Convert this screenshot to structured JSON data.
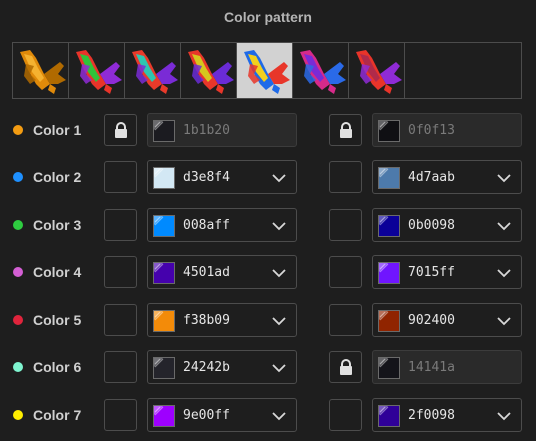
{
  "title": "Color pattern",
  "patterns": [
    {
      "name": "pattern-1",
      "colors": [
        "#e08a0a",
        "#b06a00",
        "#f5b230"
      ],
      "selected": false
    },
    {
      "name": "pattern-2",
      "colors": [
        "#e8342a",
        "#8f2bd6",
        "#2fc33a"
      ],
      "selected": false
    },
    {
      "name": "pattern-3",
      "colors": [
        "#e83a2a",
        "#7a2bd6",
        "#2ec6b0"
      ],
      "selected": false
    },
    {
      "name": "pattern-4",
      "colors": [
        "#e8362a",
        "#6a2bd6",
        "#d6c61e"
      ],
      "selected": false
    },
    {
      "name": "pattern-5",
      "colors": [
        "#1e6ae8",
        "#e8362a",
        "#f2d01e"
      ],
      "selected": true
    },
    {
      "name": "pattern-6",
      "colors": [
        "#d62a8a",
        "#2a6ae8",
        "#7a2bd6"
      ],
      "selected": false
    },
    {
      "name": "pattern-7",
      "colors": [
        "#e8342a",
        "#8f2bd6",
        "#b02a4a"
      ],
      "selected": false
    }
  ],
  "rows": [
    {
      "label": "Color 1",
      "dot": "#f39c12",
      "left": {
        "hex": "1b1b20",
        "color": "#1b1b20",
        "locked": true
      },
      "right": {
        "hex": "0f0f13",
        "color": "#0f0f13",
        "locked": true
      }
    },
    {
      "label": "Color 2",
      "dot": "#1e90ff",
      "left": {
        "hex": "d3e8f4",
        "color": "#d3e8f4",
        "locked": false
      },
      "right": {
        "hex": "4d7aab",
        "color": "#4d7aab",
        "locked": false
      }
    },
    {
      "label": "Color 3",
      "dot": "#2ecc40",
      "left": {
        "hex": "008aff",
        "color": "#008aff",
        "locked": false
      },
      "right": {
        "hex": "0b0098",
        "color": "#0b0098",
        "locked": false
      }
    },
    {
      "label": "Color 4",
      "dot": "#d45fd4",
      "left": {
        "hex": "4501ad",
        "color": "#4501ad",
        "locked": false
      },
      "right": {
        "hex": "7015ff",
        "color": "#7015ff",
        "locked": false
      }
    },
    {
      "label": "Color 5",
      "dot": "#e0243c",
      "left": {
        "hex": "f38b09",
        "color": "#f38b09",
        "locked": false
      },
      "right": {
        "hex": "902400",
        "color": "#902400",
        "locked": false
      }
    },
    {
      "label": "Color 6",
      "dot": "#7ff5d0",
      "left": {
        "hex": "24242b",
        "color": "#24242b",
        "locked": false
      },
      "right": {
        "hex": "14141a",
        "color": "#14141a",
        "locked": true
      }
    },
    {
      "label": "Color 7",
      "dot": "#ffee00",
      "left": {
        "hex": "9e00ff",
        "color": "#9e00ff",
        "locked": false
      },
      "right": {
        "hex": "2f0098",
        "color": "#2f0098",
        "locked": false
      }
    }
  ],
  "icons": {
    "lock": "lock-icon",
    "chevron": "chevron-down-icon"
  }
}
